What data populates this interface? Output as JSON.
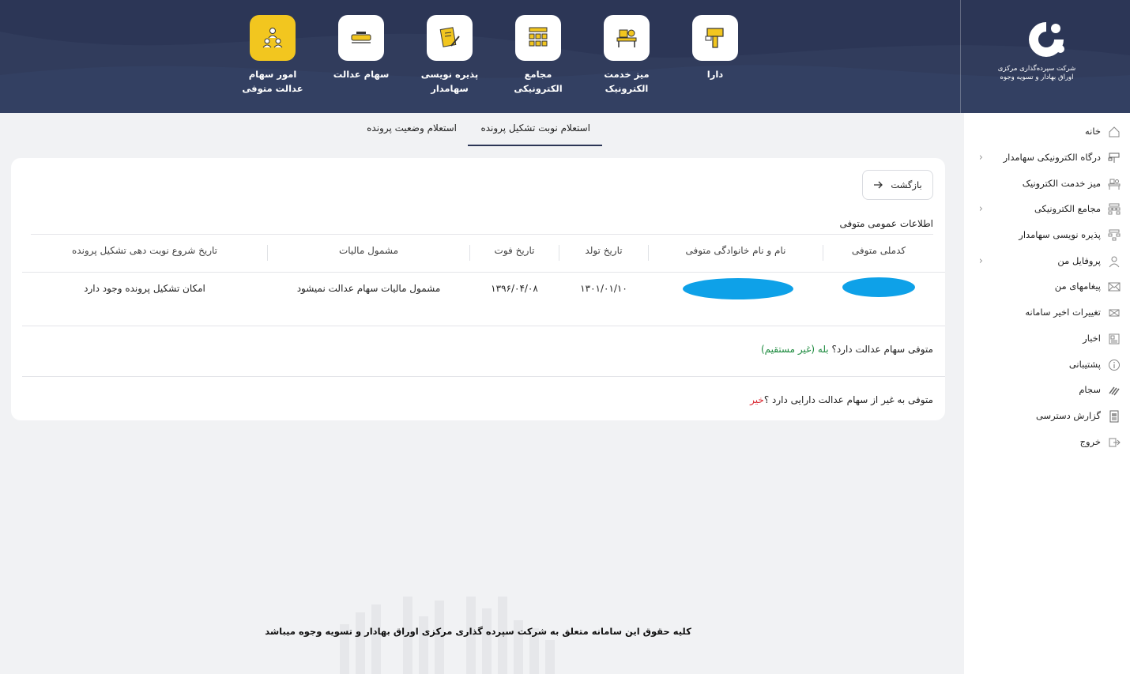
{
  "header": {
    "logo_text": "شرکت سپرده‌گذاری مرکزی اوراق بهادار و تسویه وجوه",
    "nav": [
      {
        "label": "دارا",
        "icon": "dara-icon"
      },
      {
        "label": "میز خدمت الکترونیک",
        "icon": "service-desk-icon"
      },
      {
        "label": "مجامع الکترونیکی",
        "icon": "assembly-icon"
      },
      {
        "label": "پذیره نویسی سهامدار",
        "icon": "subscription-icon"
      },
      {
        "label": "سهام عدالت",
        "icon": "edalat-shares-icon"
      },
      {
        "label": "امور سهام عدالت متوفی",
        "icon": "deceased-shares-icon"
      }
    ],
    "active_color": "#f2c61f",
    "header_color": "#2c3656"
  },
  "sidebar": {
    "items": [
      {
        "label": "خانه",
        "icon": "home-icon",
        "chevron": false
      },
      {
        "label": "درگاه الکترونیکی سهامدار",
        "icon": "portal-icon",
        "chevron": true
      },
      {
        "label": "میز خدمت الکترونیک",
        "icon": "desk-icon",
        "chevron": false
      },
      {
        "label": "مجامع الکترونیکی",
        "icon": "assembly-icon",
        "chevron": true
      },
      {
        "label": "پذیره نویسی سهامدار",
        "icon": "subscription-icon",
        "chevron": false
      },
      {
        "label": "پروفایل من",
        "icon": "user-icon",
        "chevron": true
      },
      {
        "label": "پیغامهای من",
        "icon": "mail-icon",
        "chevron": false
      },
      {
        "label": "تغییرات اخیر سامانه",
        "icon": "changes-icon",
        "chevron": false
      },
      {
        "label": "اخبار",
        "icon": "news-icon",
        "chevron": false
      },
      {
        "label": "پشتیبانی",
        "icon": "info-icon",
        "chevron": false
      },
      {
        "label": "سجام",
        "icon": "sejam-icon",
        "chevron": false
      },
      {
        "label": "گزارش دسترسی",
        "icon": "report-icon",
        "chevron": false
      },
      {
        "label": "خروج",
        "icon": "logout-icon",
        "chevron": false
      }
    ]
  },
  "tabs": {
    "active": "استعلام نوبت تشکیل پرونده",
    "other": "استعلام وضعیت پرونده"
  },
  "card": {
    "back_label": "بازگشت",
    "section_title": "اطلاعات عمومی متوفی",
    "table": {
      "headers": [
        "کدملی متوفی",
        "نام و نام خانوادگی متوفی",
        "تاریخ تولد",
        "تاریخ فوت",
        "مشمول مالیات",
        "تاریخ شروع نوبت دهی تشکیل پرونده"
      ],
      "row": {
        "birth_date": "۱۳۰۱/۰۱/۱۰",
        "death_date": "۱۳۹۶/۰۴/۰۸",
        "tax": "مشمول مالیات سهام عدالت نمیشود",
        "start": "امکان تشکیل پرونده وجود دارد"
      }
    },
    "q1": {
      "text": "متوفی سهام عدالت دارد؟",
      "answer": "بله (غیر مستقیم)"
    },
    "q2": {
      "text": "متوفی به غیر از سهام عدالت دارایی دارد ؟",
      "answer": "خیر"
    }
  },
  "footer": "کلیه حقوق این سامانه متعلق به شرکت سپرده گذاری مرکزی اوراق بهادار و تسویه وجوه میباشد"
}
